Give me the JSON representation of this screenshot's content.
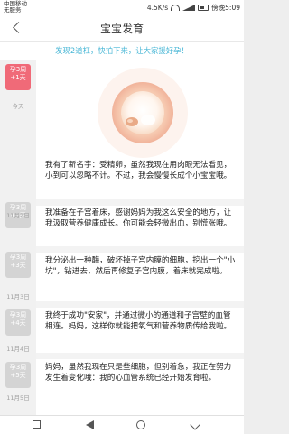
{
  "status_bar": {
    "carrier_line1": "中国移动",
    "carrier_line2": "无服务",
    "speed": "4.5K/s",
    "battery": "傍晚5:09"
  },
  "header": {
    "title": "宝宝发育"
  },
  "banner": {
    "text": "发现2道杠，快拍下来，让大家援好孕！"
  },
  "sidebar": {
    "items": [
      {
        "line1": "孕3周",
        "line2": "+1天",
        "date": "今天",
        "active": true
      },
      {
        "line1": "孕3周",
        "line2": "+2天",
        "date": "11月2日",
        "active": false
      },
      {
        "line1": "孕3周",
        "line2": "+3天",
        "date": "11月3日",
        "active": false
      },
      {
        "line1": "孕3周",
        "line2": "+4天",
        "date": "11月4日",
        "active": false
      },
      {
        "line1": "孕3周",
        "line2": "+5天",
        "date": "11月5日",
        "active": false
      }
    ]
  },
  "entries": [
    {
      "text": "我有了新名字：受精卵，虽然我现在用肉眼无法看见，小到可以忽略不计。不过，我会慢慢长成个小宝宝哦。"
    },
    {
      "text": "我准备在子宫着床，感谢妈妈为我这么安全的地方，让我汲取营养健康成长。你可能会轻微出血，别慌张哦。"
    },
    {
      "text": "我分泌出一种酶，破坏掉子宫内膜的细胞，挖出一个\"小坑\"，钻进去，然后再修复子宫内膜，着床就完成啦。"
    },
    {
      "text": "我终于成功\"安家\"，并通过微小的通道和子宫壁的血管相连。妈妈，这样你就能把氧气和营养物质传给我啦。"
    },
    {
      "text": "妈妈，虽然我现在只是些细胞，但别着急，我正在努力发生着变化哦：我的心血管系统已经开始发育啦。"
    }
  ],
  "colors": {
    "accent_pink": "#f06a78",
    "banner_blue": "#49b7d6",
    "inactive_day": "#d4d4d4"
  }
}
